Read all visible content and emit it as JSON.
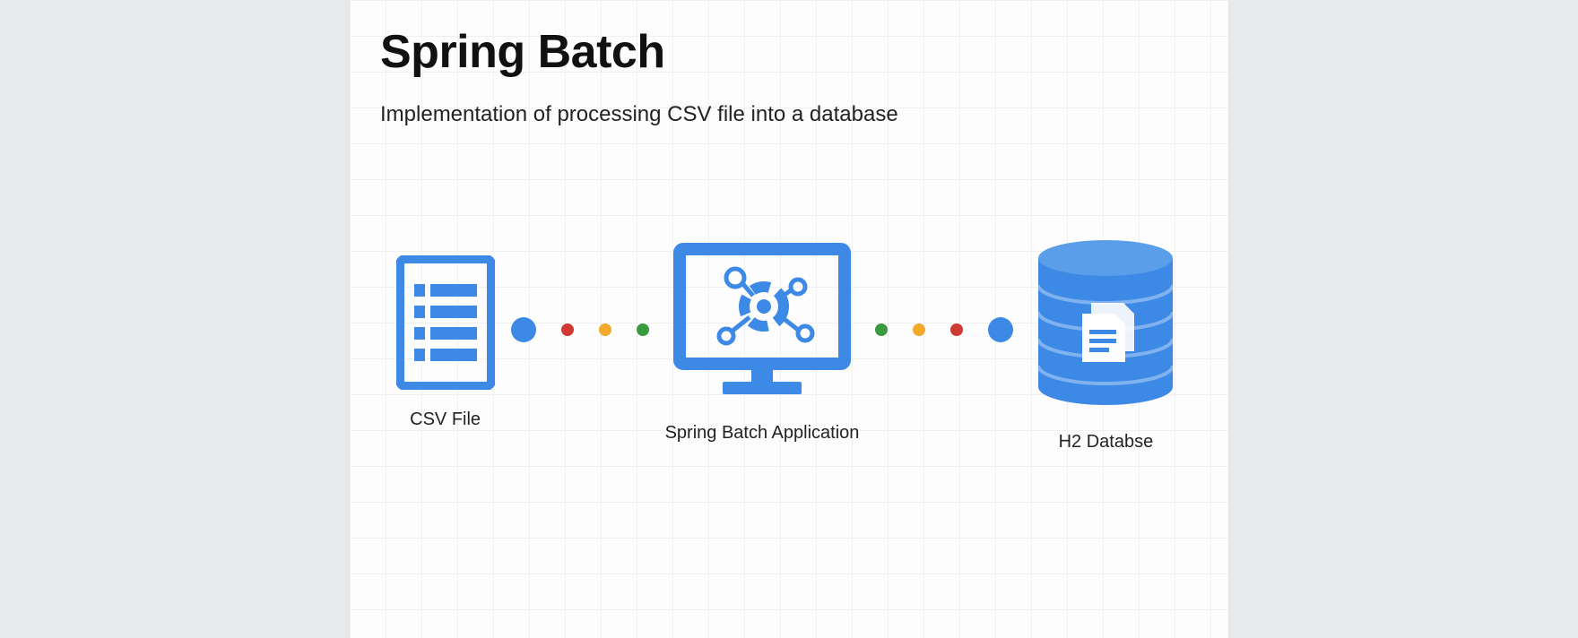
{
  "title": "Spring Batch",
  "subtitle": "Implementation of processing CSV file into a database",
  "nodes": {
    "csv": {
      "label": "CSV File"
    },
    "app": {
      "label": "Spring Batch Application"
    },
    "db": {
      "label": "H2 Databse"
    }
  },
  "connector_dots": {
    "first": [
      "blue-big",
      "red-small",
      "orange-small",
      "green-small"
    ],
    "second": [
      "green-small",
      "orange-small",
      "red-small",
      "blue-big"
    ]
  },
  "colors": {
    "primary_blue": "#3d89e6",
    "red": "#cf3833",
    "orange": "#f2a92c",
    "green": "#3a9a41",
    "page_bg": "#e9eaec",
    "canvas_bg": "#fdfdfd"
  }
}
